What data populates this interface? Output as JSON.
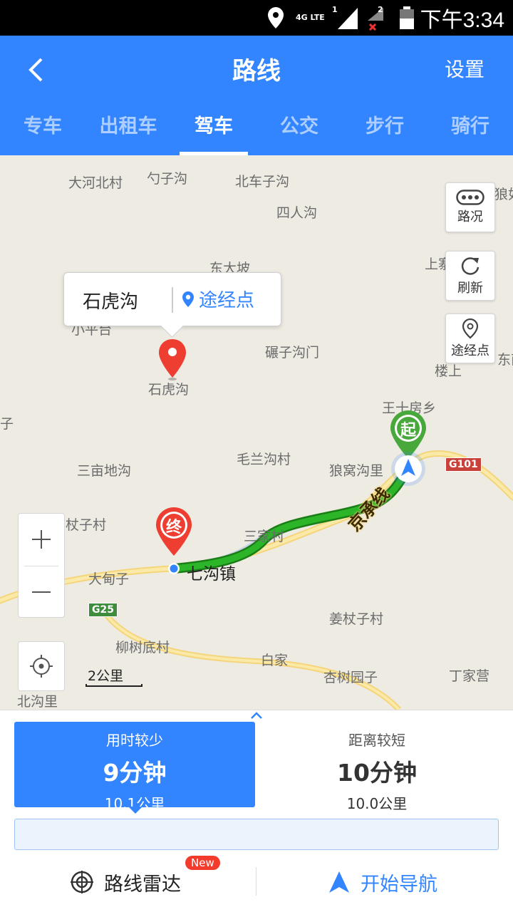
{
  "status_bar": {
    "network": "4G LTE",
    "sim1": "1",
    "sim2": "2",
    "time": "下午3:34"
  },
  "header": {
    "title": "路线",
    "settings_label": "设置",
    "tabs": [
      {
        "label": "专车",
        "active": false
      },
      {
        "label": "出租车",
        "active": false
      },
      {
        "label": "驾车",
        "active": true
      },
      {
        "label": "公交",
        "active": false
      },
      {
        "label": "步行",
        "active": false
      },
      {
        "label": "骑行",
        "active": false
      }
    ]
  },
  "map": {
    "places": [
      "大河北村",
      "勺子沟",
      "北车子沟",
      "四人沟",
      "东大坡",
      "上寨",
      "小平台",
      "碾子沟门",
      "楼上",
      "东南",
      "王十房乡",
      "石虎沟",
      "子",
      "毛兰沟村",
      "狼窝沟里",
      "三亩地沟",
      "杖子村",
      "三家村",
      "大甸子",
      "七沟镇",
      "柳树底村",
      "白家",
      "姜杖子村",
      "杏树园子",
      "丁家营",
      "北沟里",
      "狼如"
    ],
    "road_badges": {
      "g101": "G101",
      "g25": "G25",
      "s101": "101"
    },
    "expressway_label": "京承线",
    "start_marker": "起",
    "end_marker": "终",
    "callout": {
      "name": "石虎沟",
      "action": "途经点"
    },
    "buttons": {
      "traffic": "路况",
      "refresh": "刷新",
      "waypoint": "途经点"
    },
    "scale": "2公里",
    "accent_color": "#3385ff",
    "route_color": "#2db52a"
  },
  "routes": [
    {
      "label": "用时较少",
      "time": "9分钟",
      "distance": "10.1公里",
      "selected": true
    },
    {
      "label": "距离较短",
      "time": "10分钟",
      "distance": "10.0公里",
      "selected": false
    }
  ],
  "actions": {
    "radar": "路线雷达",
    "new_badge": "New",
    "navigate": "开始导航"
  }
}
